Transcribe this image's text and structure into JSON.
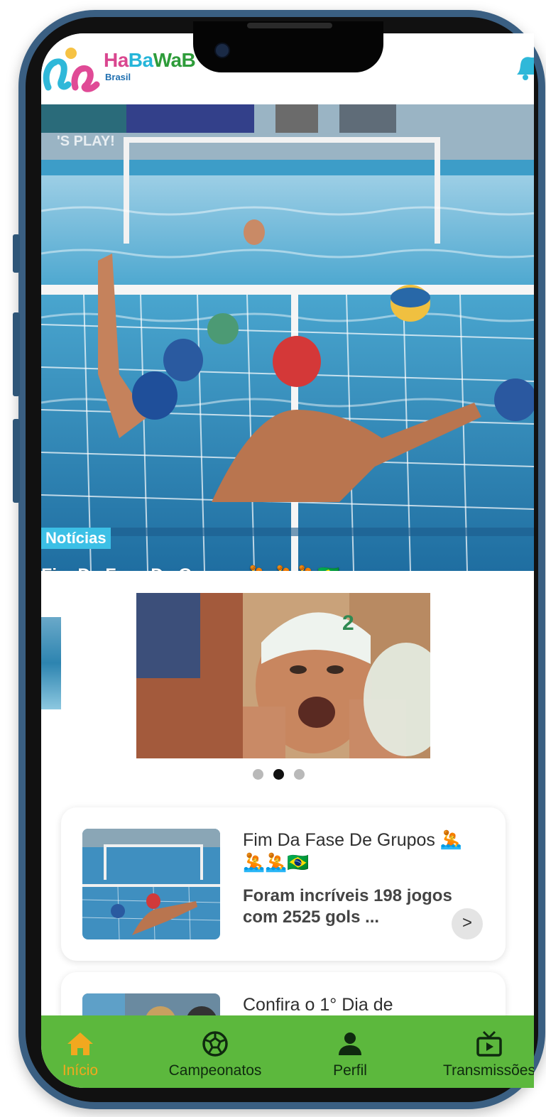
{
  "app": {
    "logo_brand_part1": "Ha",
    "logo_brand_part2": "Ba",
    "logo_brand_part3": "WaB",
    "logo_subtitle": "Brasil"
  },
  "hero": {
    "badge": "Notícias",
    "title": "Fim Da Fase De Grupos 🤽 🤽🤽🇧🇷"
  },
  "carousel": {
    "active_index": 1,
    "total": 3
  },
  "news": [
    {
      "title": "Fim Da Fase De Grupos 🤽🤽🤽🇧🇷",
      "description": "Foram incríveis 198 jogos com 2525 gols ...",
      "arrow": ">"
    },
    {
      "title": "Confira o 1° Dia de",
      "description": "",
      "arrow": ""
    }
  ],
  "nav": {
    "items": [
      {
        "label": "Início",
        "icon": "home-icon",
        "active": true
      },
      {
        "label": "Campeonatos",
        "icon": "ball-icon",
        "active": false
      },
      {
        "label": "Perfil",
        "icon": "person-icon",
        "active": false
      },
      {
        "label": "Transmissões",
        "icon": "tv-icon",
        "active": false
      }
    ]
  },
  "colors": {
    "nav_bg": "#5cb83d",
    "active_nav": "#f2a81f",
    "badge_bg": "#3cc0e6",
    "frame": "#3a5f82"
  }
}
